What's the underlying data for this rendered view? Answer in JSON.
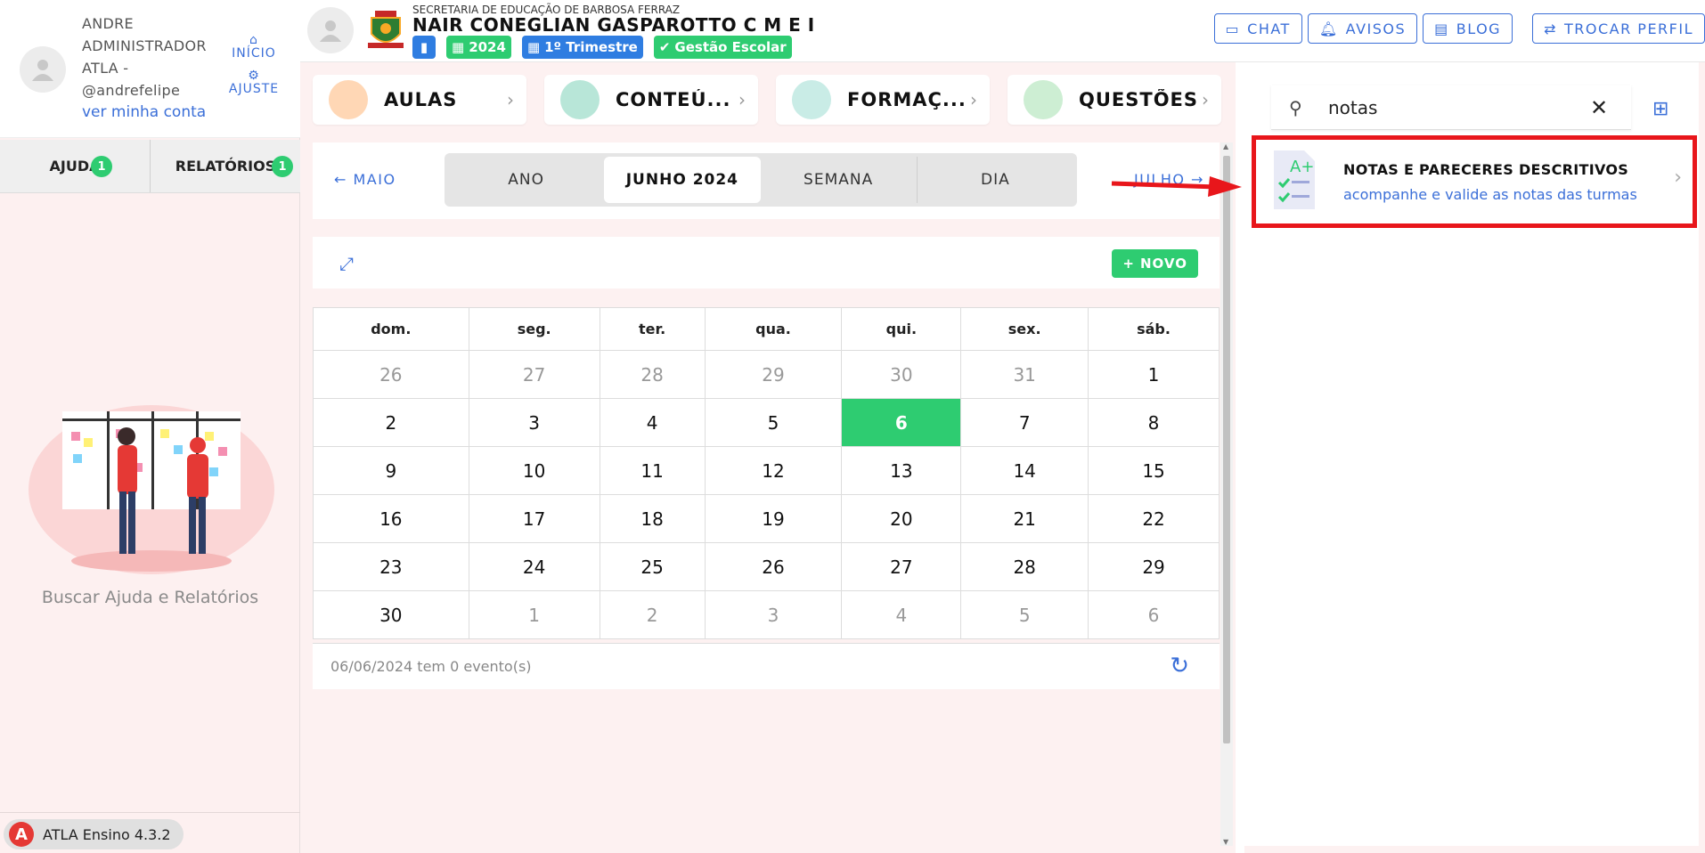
{
  "sidebar": {
    "user_name": "ANDRE ADMINISTRADOR ATLA - @andrefelipe",
    "account_link": "ver minha conta",
    "nav": {
      "home": "INÍCIO",
      "settings": "AJUSTE"
    },
    "tabs": [
      {
        "label": "AJUDA",
        "badge": "1"
      },
      {
        "label": "RELATÓRIOS",
        "badge": "1"
      }
    ],
    "help_text": "Buscar Ajuda e Relatórios",
    "version": "ATLA Ensino 4.3.2"
  },
  "header": {
    "subtitle": "SECRETARIA DE EDUCAÇÃO DE BARBOSA FERRAZ",
    "school": "NAIR CONEGLIAN GASPAROTTO C M E I",
    "chips": {
      "year": "2024",
      "term": "1º Trimestre",
      "mode": "Gestão Escolar"
    },
    "buttons": {
      "chat": "CHAT",
      "avisos": "AVISOS",
      "blog": "BLOG",
      "trocar": "TROCAR PERFIL"
    }
  },
  "big_tabs": [
    "AULAS",
    "CONTEÚ...",
    "FORMAÇ...",
    "QUESTÕES"
  ],
  "period": {
    "prev": "MAIO",
    "next": "JULHO",
    "views": [
      "ANO",
      "JUNHO 2024",
      "SEMANA",
      "DIA"
    ]
  },
  "toolbar": {
    "new": "NOVO"
  },
  "calendar": {
    "weekdays": [
      "dom.",
      "seg.",
      "ter.",
      "qua.",
      "qui.",
      "sex.",
      "sáb."
    ],
    "weeks": [
      [
        "26",
        "27",
        "28",
        "29",
        "30",
        "31",
        "1"
      ],
      [
        "2",
        "3",
        "4",
        "5",
        "6",
        "7",
        "8"
      ],
      [
        "9",
        "10",
        "11",
        "12",
        "13",
        "14",
        "15"
      ],
      [
        "16",
        "17",
        "18",
        "19",
        "20",
        "21",
        "22"
      ],
      [
        "23",
        "24",
        "25",
        "26",
        "27",
        "28",
        "29"
      ],
      [
        "30",
        "1",
        "2",
        "3",
        "4",
        "5",
        "6"
      ]
    ],
    "footer": "06/06/2024 tem 0 evento(s)"
  },
  "right": {
    "search_value": "notas",
    "result_title": "NOTAS E PARECERES DESCRITIVOS",
    "result_sub": "acompanhe e valide as notas das turmas"
  },
  "colors": {
    "accent": "#3b6fd8",
    "green": "#2ecc71",
    "highlight": "#e8161b"
  }
}
